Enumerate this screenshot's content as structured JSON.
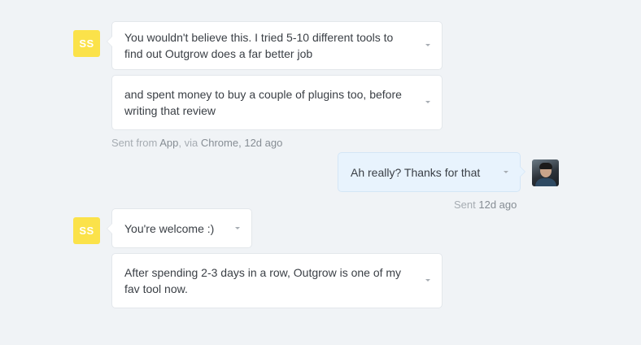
{
  "conversation": {
    "group1": {
      "avatar_initials": "SS",
      "messages": [
        "You wouldn't believe this. I tried 5-10 different tools to find out Outgrow does a far better job",
        "and spent money to buy a couple of plugins too, before writing that review"
      ],
      "meta": {
        "prefix": "Sent from ",
        "app": "App",
        "via": ", via ",
        "browser": "Chrome",
        "time": ", 12d ago"
      }
    },
    "reply": {
      "message": "Ah really? Thanks for that",
      "meta": {
        "prefix": "Sent ",
        "time": "12d ago"
      }
    },
    "group2": {
      "avatar_initials": "SS",
      "messages": [
        "You're welcome :)",
        "After spending 2-3 days in a row, Outgrow is one of my fav tool now."
      ]
    }
  },
  "colors": {
    "background": "#f0f3f6",
    "avatar_yellow": "#fbe24a",
    "my_bubble": "#e8f3fd",
    "meta_text": "#a6acb2"
  },
  "icons": {
    "message_menu": "chevron-down-icon"
  }
}
